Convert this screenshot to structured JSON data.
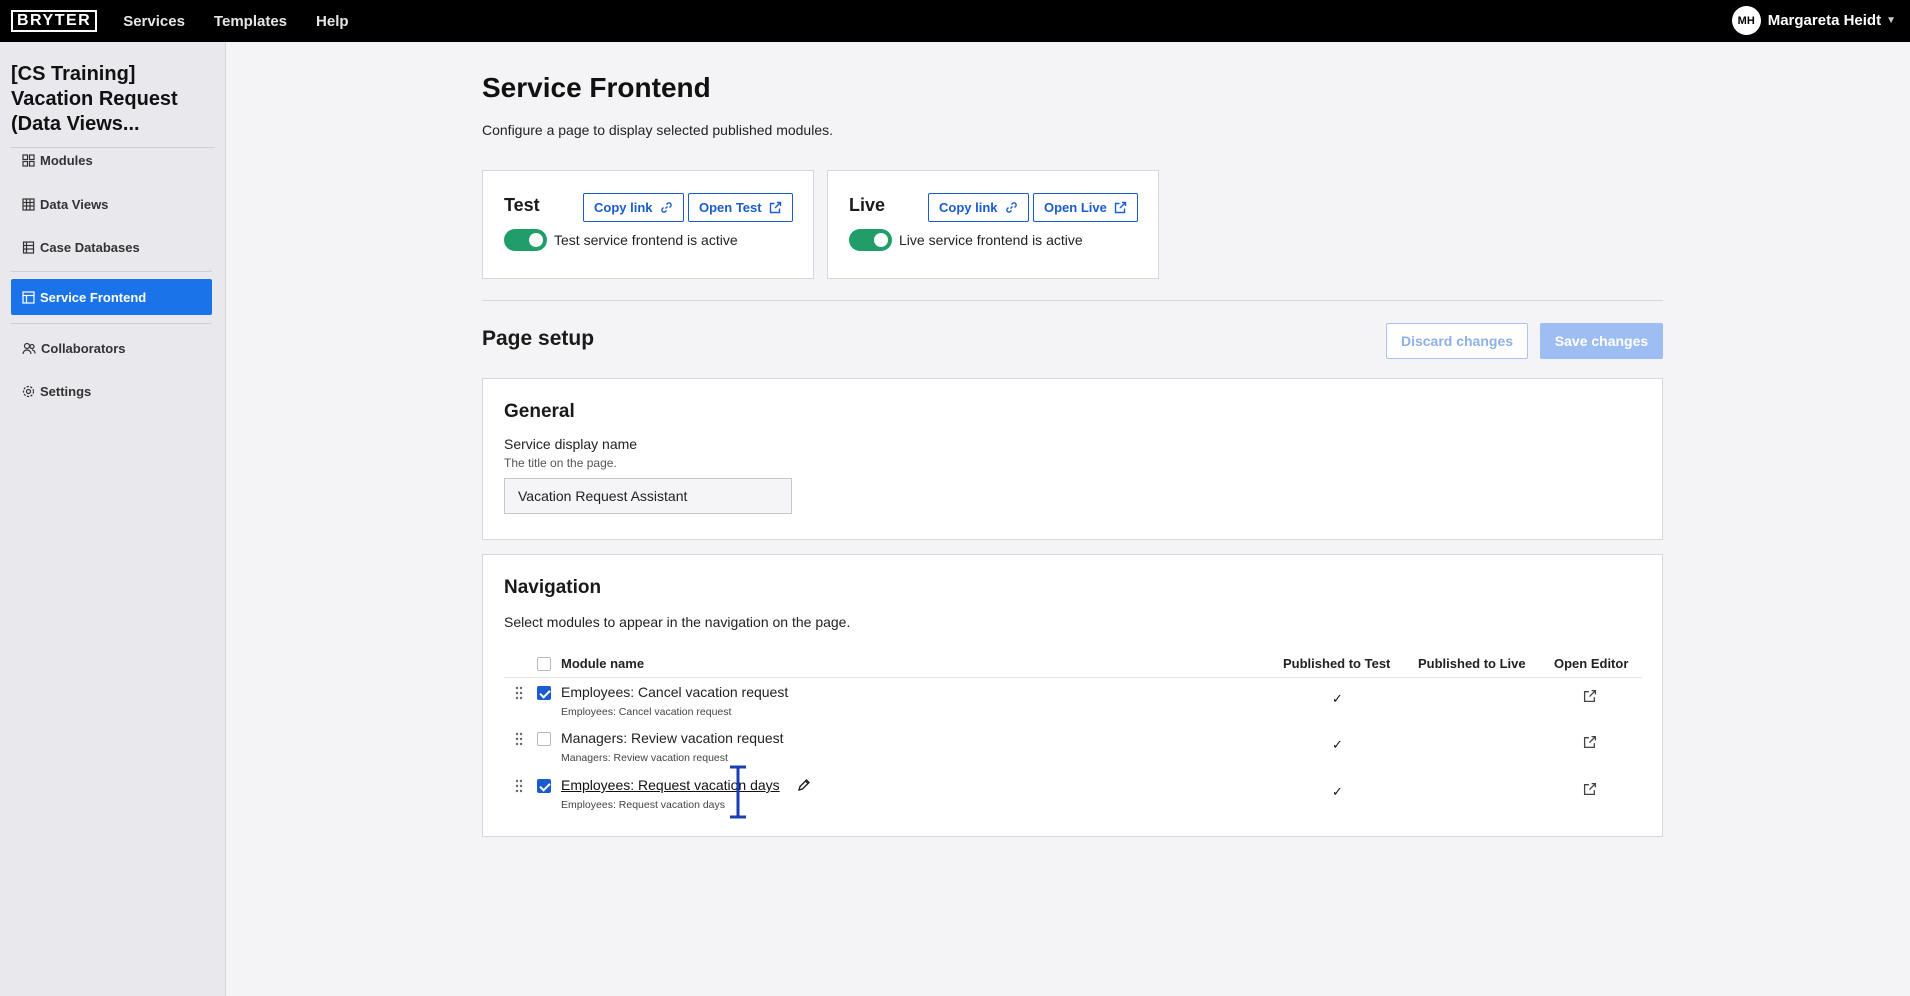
{
  "topbar": {
    "logo": "BRYTER",
    "nav": [
      "Services",
      "Templates",
      "Help"
    ],
    "user_initials": "MH",
    "user_name": "Margareta Heidt"
  },
  "sidebar": {
    "project_title": "[CS Training] Vacation Request (Data Views...",
    "items": [
      {
        "label": "Modules",
        "icon": "grid-icon"
      },
      {
        "label": "Data Views",
        "icon": "table-icon"
      },
      {
        "label": "Case Databases",
        "icon": "database-icon"
      },
      {
        "label": "Service Frontend",
        "icon": "layout-icon",
        "active": true
      },
      {
        "label": "Collaborators",
        "icon": "users-icon"
      },
      {
        "label": "Settings",
        "icon": "gear-icon"
      }
    ]
  },
  "page": {
    "title": "Service Frontend",
    "description": "Configure a page to display selected published modules."
  },
  "environments": {
    "test": {
      "name": "Test",
      "copy_label": "Copy link",
      "open_label": "Open Test",
      "status": "Test service frontend is active",
      "active": true
    },
    "live": {
      "name": "Live",
      "copy_label": "Copy link",
      "open_label": "Open Live",
      "status": "Live service frontend is active",
      "active": true
    }
  },
  "page_setup": {
    "title": "Page setup",
    "discard_label": "Discard changes",
    "save_label": "Save changes"
  },
  "general": {
    "title": "General",
    "field_label": "Service display name",
    "field_help": "The title on the page.",
    "field_value": "Vacation Request Assistant"
  },
  "navigation": {
    "title": "Navigation",
    "description": "Select modules to appear in the navigation on the page.",
    "columns": {
      "name": "Module name",
      "test": "Published to Test",
      "live": "Published to Live",
      "editor": "Open Editor"
    },
    "rows": [
      {
        "name": "Employees: Cancel vacation request",
        "subtitle": "Employees: Cancel vacation request",
        "checked": true,
        "published_test": "✓",
        "published_live": ""
      },
      {
        "name": "Managers: Review vacation request",
        "subtitle": "Managers: Review vacation request",
        "checked": false,
        "published_test": "✓",
        "published_live": ""
      },
      {
        "name": "Employees: Request vacation days",
        "subtitle": "Employees: Request vacation days",
        "checked": true,
        "published_test": "✓",
        "published_live": ""
      }
    ]
  },
  "colors": {
    "accent": "#1a73e8",
    "toggle_on": "#1f9e6a",
    "topbar": "#000000"
  }
}
